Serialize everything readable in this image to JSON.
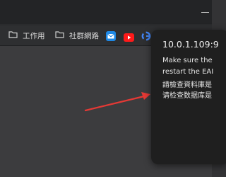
{
  "bookmarks": [
    {
      "label": "工作用",
      "icon": "folder-icon"
    },
    {
      "label": "社群網路",
      "icon": "folder-icon"
    }
  ],
  "extension_icons": [
    "mail-icon",
    "youtube-icon",
    "google-icon"
  ],
  "popup": {
    "title": "10.0.1.109:9",
    "lines": [
      "Make sure the",
      "restart the EAI",
      "請檢查資料庫是",
      "请检查数据库是"
    ]
  },
  "annotation": {
    "type": "arrow",
    "color": "#e53935"
  }
}
